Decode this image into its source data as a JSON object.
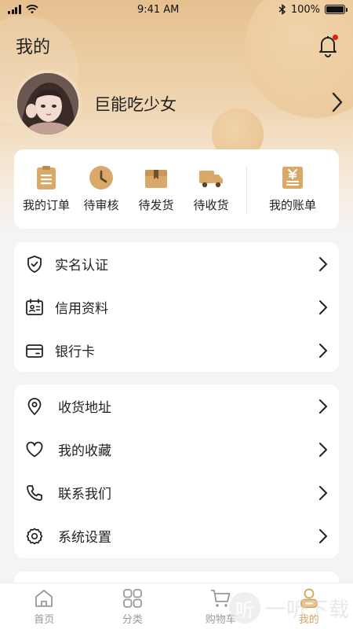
{
  "status_bar": {
    "time": "9:41 AM",
    "battery": "100%"
  },
  "header": {
    "title": "我的"
  },
  "profile": {
    "name": "巨能吃少女"
  },
  "orders": {
    "items": [
      {
        "label": "我的订单",
        "icon": "clipboard-icon"
      },
      {
        "label": "待审核",
        "icon": "clock-icon"
      },
      {
        "label": "待发货",
        "icon": "package-box-icon"
      },
      {
        "label": "待收货",
        "icon": "delivery-truck-icon"
      }
    ],
    "bill": {
      "label": "我的账单",
      "icon": "bill-yen-icon"
    }
  },
  "menu_group_1": [
    {
      "label": "实名认证",
      "icon": "shield-check-icon"
    },
    {
      "label": "信用资料",
      "icon": "id-card-icon"
    },
    {
      "label": "银行卡",
      "icon": "bank-card-icon"
    }
  ],
  "menu_group_2": [
    {
      "label": "收货地址",
      "icon": "location-pin-icon"
    },
    {
      "label": "我的收藏",
      "icon": "heart-icon"
    },
    {
      "label": "联系我们",
      "icon": "phone-icon"
    },
    {
      "label": "系统设置",
      "icon": "settings-gear-icon"
    }
  ],
  "tabbar": {
    "tabs": [
      {
        "label": "首页",
        "icon": "home-icon",
        "active": false
      },
      {
        "label": "分类",
        "icon": "category-grid-icon",
        "active": false
      },
      {
        "label": "购物车",
        "icon": "cart-icon",
        "active": false
      },
      {
        "label": "我的",
        "icon": "user-icon",
        "active": true
      }
    ]
  },
  "watermark": {
    "glyph": "听",
    "text": "一听下载"
  },
  "colors": {
    "accent": "#d4a25e",
    "icon_gold": "#d9a969",
    "hero_top": "#e6c08f",
    "badge_red": "#e02020"
  }
}
